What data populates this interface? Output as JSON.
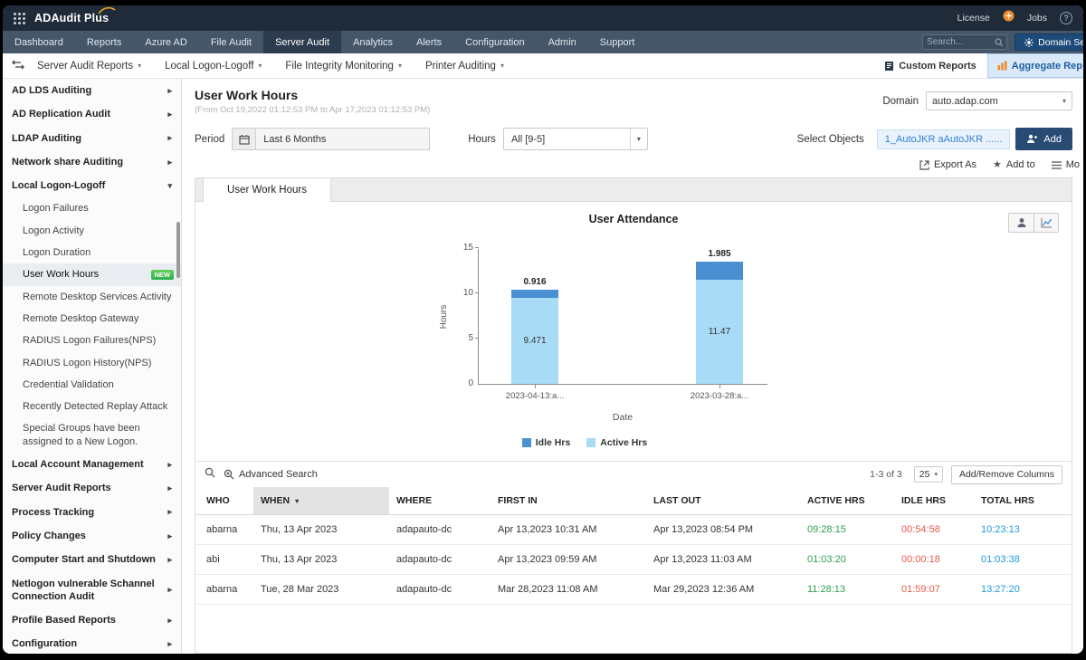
{
  "topbar": {
    "app_name": "ADAudit Plus",
    "license_label": "License",
    "jobs_label": "Jobs",
    "help_label": "?"
  },
  "nav": {
    "items": [
      "Dashboard",
      "Reports",
      "Azure AD",
      "File Audit",
      "Server Audit",
      "Analytics",
      "Alerts",
      "Configuration",
      "Admin",
      "Support"
    ],
    "active_item": "Server Audit",
    "search_placeholder": "Search...",
    "domain_settings_label": "Domain Set"
  },
  "subnav": {
    "items": [
      "Server Audit Reports",
      "Local Logon-Logoff",
      "File Integrity Monitoring",
      "Printer Auditing"
    ],
    "custom_reports_label": "Custom Reports",
    "aggregate_reports_label": "Aggregate Rep"
  },
  "sidebar": {
    "items": [
      {
        "label": "AD LDS Auditing"
      },
      {
        "label": "AD Replication Audit"
      },
      {
        "label": "LDAP Auditing"
      },
      {
        "label": "Network share Auditing"
      },
      {
        "label": "Local Logon-Logoff",
        "expanded": true,
        "children": [
          {
            "label": "Logon Failures"
          },
          {
            "label": "Logon Activity"
          },
          {
            "label": "Logon Duration"
          },
          {
            "label": "User Work Hours",
            "badge": "NEW",
            "selected": true
          },
          {
            "label": "Remote Desktop Services Activity"
          },
          {
            "label": "Remote Desktop Gateway"
          },
          {
            "label": "RADIUS Logon Failures(NPS)"
          },
          {
            "label": "RADIUS Logon History(NPS)"
          },
          {
            "label": "Credential Validation"
          },
          {
            "label": "Recently Detected Replay Attack"
          },
          {
            "label": "Special Groups have been assigned to a New Logon."
          }
        ]
      },
      {
        "label": "Local Account Management"
      },
      {
        "label": "Server Audit Reports"
      },
      {
        "label": "Process Tracking"
      },
      {
        "label": "Policy Changes"
      },
      {
        "label": "Computer Start and Shutdown"
      },
      {
        "label": "Netlogon vulnerable Schannel Connection Audit"
      },
      {
        "label": "Profile Based Reports"
      },
      {
        "label": "Configuration"
      }
    ]
  },
  "page": {
    "title": "User Work Hours",
    "date_range": "(From Oct 19,2022 01:12:53 PM to Apr 17,2023 01:12:53 PM)",
    "domain_label": "Domain",
    "domain_value": "auto.adap.com",
    "period_label": "Period",
    "period_value": "Last 6 Months",
    "hours_label": "Hours",
    "hours_value": "All [9-5]",
    "select_objects_label": "Select Objects",
    "selected_objects": "1_AutoJKR aAutoJKR ......",
    "add_button_label": "Add",
    "export_as_label": "Export As",
    "add_to_label": "Add to",
    "more_label": "Mo",
    "tab_label": "User Work Hours"
  },
  "chart_data": {
    "type": "bar",
    "stacked": true,
    "title": "User Attendance",
    "categories": [
      "2023-04-13:a...",
      "2023-03-28:a..."
    ],
    "series": [
      {
        "name": "Idle Hrs",
        "values": [
          0.916,
          1.985
        ],
        "color": "#4a8fd1"
      },
      {
        "name": "Active Hrs",
        "values": [
          9.471,
          11.47
        ],
        "color": "#a8dbf5"
      }
    ],
    "xlabel": "Date",
    "ylabel": "Hours",
    "ylim": [
      0,
      15
    ],
    "yticks": [
      0,
      5,
      10,
      15
    ],
    "legend_position": "bottom",
    "grid": false
  },
  "report_table": {
    "advanced_search_label": "Advanced Search",
    "pagination_label": "1-3 of 3",
    "page_size": "25",
    "add_remove_columns_label": "Add/Remove Columns",
    "columns": [
      "WHO",
      "WHEN",
      "WHERE",
      "FIRST IN",
      "LAST OUT",
      "ACTIVE HRS",
      "IDLE HRS",
      "TOTAL HRS"
    ],
    "sorted_column": "WHEN",
    "rows": [
      [
        "abarna",
        "Thu, 13 Apr 2023",
        "adapauto-dc",
        "Apr 13,2023 10:31 AM",
        "Apr 13,2023 08:54 PM",
        "09:28:15",
        "00:54:58",
        "10:23:13"
      ],
      [
        "abi",
        "Thu, 13 Apr 2023",
        "adapauto-dc",
        "Apr 13,2023 09:59 AM",
        "Apr 13,2023 11:03 AM",
        "01:03:20",
        "00:00:18",
        "01:03:38"
      ],
      [
        "abarna",
        "Tue, 28 Mar 2023",
        "adapauto-dc",
        "Mar 28,2023 11:08 AM",
        "Mar 29,2023 12:36 AM",
        "11:28:13",
        "01:59:07",
        "13:27:20"
      ]
    ]
  },
  "colors": {
    "active_hrs": "#2e9e50",
    "idle_hrs": "#e8594a",
    "total_hrs": "#1c9ad6",
    "accent_blue": "#2e7fd0",
    "topbar_bg": "#202b3a",
    "nav_bg": "#455668",
    "badge_green": "#3cb550"
  }
}
